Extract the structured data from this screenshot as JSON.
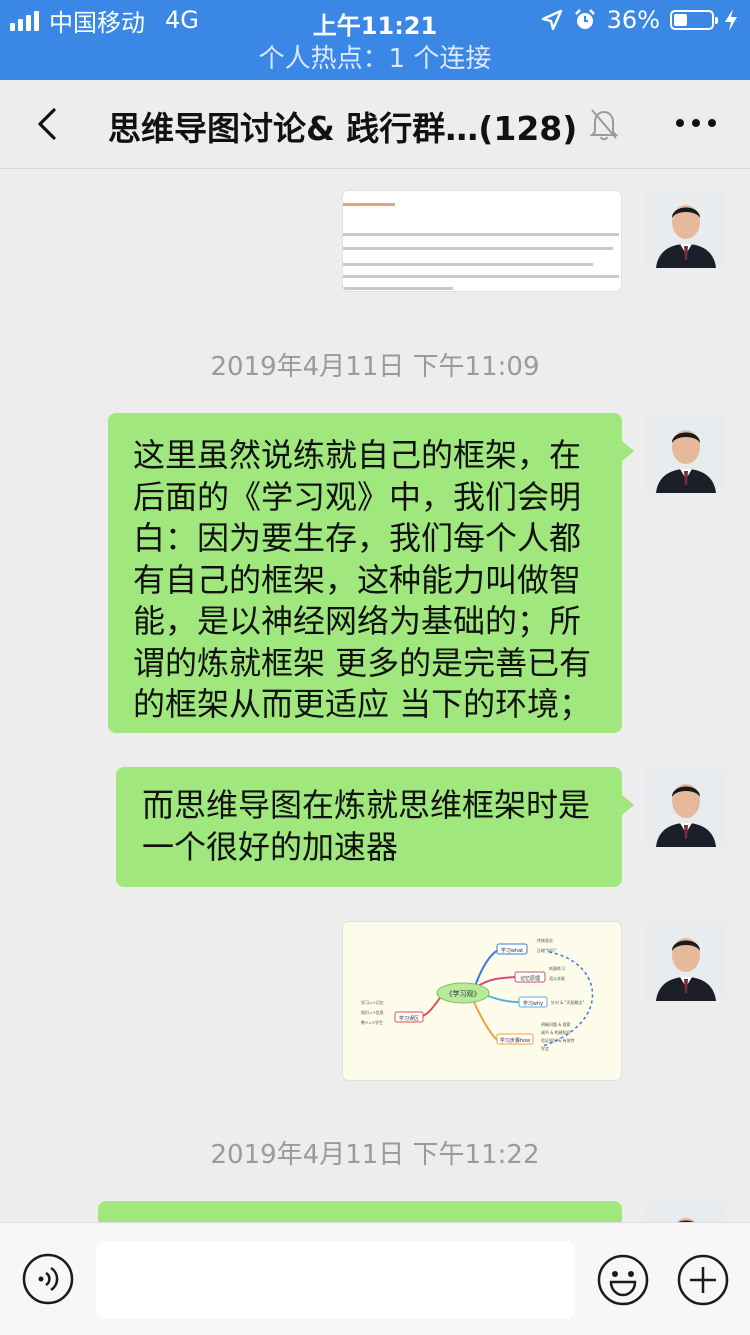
{
  "status_bar": {
    "carrier": "中国移动",
    "network": "4G",
    "time": "上午11:21",
    "battery": "36%",
    "battery_level": 0.36,
    "hotspot": "个人热点：1 个连接"
  },
  "header": {
    "title": "思维导图讨论& 践行群…",
    "member_count": "(128)"
  },
  "messages": {
    "ts1": "2019年4月11日 下午11:09",
    "msg1": [
      "这里虽然说练就自己的框架，在",
      "后面的《学习观》中，我们会明",
      "白：因为要生存，我们每个人都",
      "有自己的框架，这种能力叫做智",
      "能，是以神经网络为基础的；所",
      "谓的炼就框架 更多的是完善已有",
      "的框架从而更适应 当下的环境；"
    ],
    "msg2": [
      "而思维导图在炼就思维框架时是",
      "一个很好的加速器"
    ],
    "mindmap": {
      "center": "《学习观》",
      "what": "学习what",
      "memory": "记忆原理",
      "why": "学习why",
      "how": "学习步骤how",
      "misc": "学习误区",
      "n1": "传统观念",
      "n2": "压缩\"知识\"",
      "n3": "刻意练习",
      "n4": "语义关联",
      "n5": "针对 & \"天赋概念\"",
      "n6": "明确问题 & 搜索",
      "n7": "调节 & 构建知识",
      "n8": "验证知识 & 有效性",
      "n9": "学会",
      "m1": "学习=>记忆",
      "m2": "知识=>信息",
      "m3": "教<=>学生"
    },
    "ts2": "2019年4月11日 下午11:22"
  },
  "input": {
    "value": "",
    "placeholder": ""
  }
}
